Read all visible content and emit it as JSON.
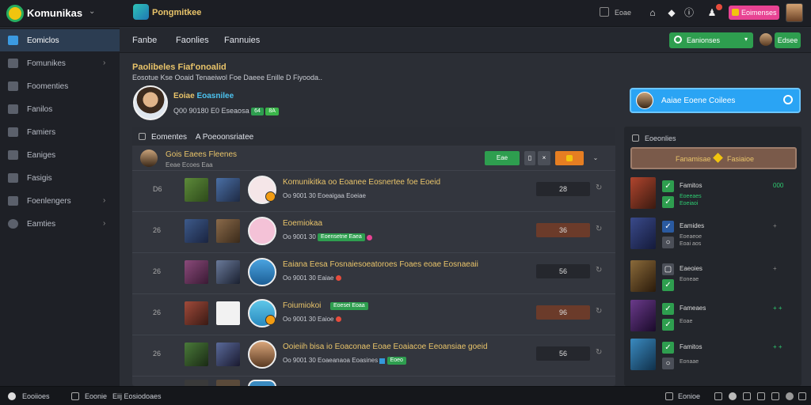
{
  "app": {
    "name": "Komunikas",
    "brand": "Pongmitkee",
    "top_date": "Eoae",
    "top_button": "Eoimenses"
  },
  "sidebar": {
    "items": [
      {
        "label": "Eomiclos",
        "active": true,
        "chevron": false
      },
      {
        "label": "Fomunikes",
        "active": false,
        "chevron": true
      },
      {
        "label": "Foomenties",
        "active": false,
        "chevron": false
      },
      {
        "label": "Fanilos",
        "active": false,
        "chevron": false
      },
      {
        "label": "Famiers",
        "active": false,
        "chevron": false
      },
      {
        "label": "Eaniges",
        "active": false,
        "chevron": false
      },
      {
        "label": "Fasigis",
        "active": false,
        "chevron": false
      },
      {
        "label": "Foenlengers",
        "active": false,
        "chevron": true
      },
      {
        "label": "Eamties",
        "active": false,
        "chevron": true
      }
    ]
  },
  "subnav": {
    "tabs": [
      "Fanbe",
      "Faonlies",
      "Fannuies"
    ],
    "search_label": "Eanionses",
    "action_label": "Edsee"
  },
  "header": {
    "title": "Paolibeles Fiaf'onoalid",
    "subtitle": "Eosotue Kse Ooaid Tenaeiwol Foe Daeee Enille D Fiyooda..",
    "profile_name_1": "Eoiae",
    "profile_name_2": "Eoasnilee",
    "profile_meta": "Q00 90180 E0 Eseaosa",
    "profile_pill_1": "64",
    "profile_pill_2": "8A"
  },
  "blue_card": {
    "label": "Aaiae Eoene Coilees"
  },
  "main_panel": {
    "title": "Eomentes",
    "title_suffix": "A Poeoonsriatee",
    "group_name": "Gois Eaees Fleenes",
    "group_sub": "Eeae Ecoes Eaa",
    "btn_green": "Eae",
    "btn_orange": "",
    "rows": [
      {
        "num": "D6",
        "title": "Komunikitka oo Eoanee Eosnertee foe Eoeid",
        "meta": "Oo 9001 30  Eoeaigaa Eoeiae",
        "score": "28",
        "score_brown": false
      },
      {
        "num": "26",
        "title": "Eoemiokaa",
        "meta": "Oo 9001 30",
        "pill": "Eoensetne Eaea",
        "score": "36",
        "score_brown": true
      },
      {
        "num": "26",
        "title": "Eaiana Eesa  Fosnaiesoeatoroes Foaes eoae Eosnaeaii",
        "meta": "Oo 9001 30  Eaiae",
        "score": "56",
        "score_brown": false
      },
      {
        "num": "26",
        "title": "Foiumiokoi",
        "meta": "Oo 9001 30  Eaioe",
        "pill": "Eoesei Eoaa",
        "score": "96",
        "score_brown": true
      },
      {
        "num": "26",
        "title": "Ooieiih bisa  io Eoaconae Eoae Eoaiacoe Eeoansiae goeid",
        "meta": "Oo 9001 30  Eoaeanaoa Eoasines",
        "pill": "Eoeo",
        "score": "56",
        "score_brown": false
      }
    ]
  },
  "right_panel": {
    "title": "Eoeonlies",
    "tab_left": "Fanamisae",
    "tab_right": "Fasiaioe",
    "rows": [
      {
        "name": "Famitos",
        "sub": "Eoeeaes",
        "sub2": "Eoeiaoi",
        "right": "000"
      },
      {
        "name": "Eamides",
        "sub": "Eoeaeoe",
        "sub2": "Eoai aos",
        "right": "+"
      },
      {
        "name": "Eaeoies",
        "sub": "Eoneae",
        "sub2": "",
        "right": "+"
      },
      {
        "name": "Fameaes",
        "sub": "Eoae",
        "sub2": "",
        "right": "+ +"
      },
      {
        "name": "Famitos",
        "sub": "Eonaae",
        "sub2": "",
        "right": "+ +"
      }
    ]
  },
  "footer": {
    "left": "Eooiioes",
    "mid_1": "Eoonie",
    "mid_2": "Eiij Eosiodoaes",
    "right": "Eonioe"
  }
}
